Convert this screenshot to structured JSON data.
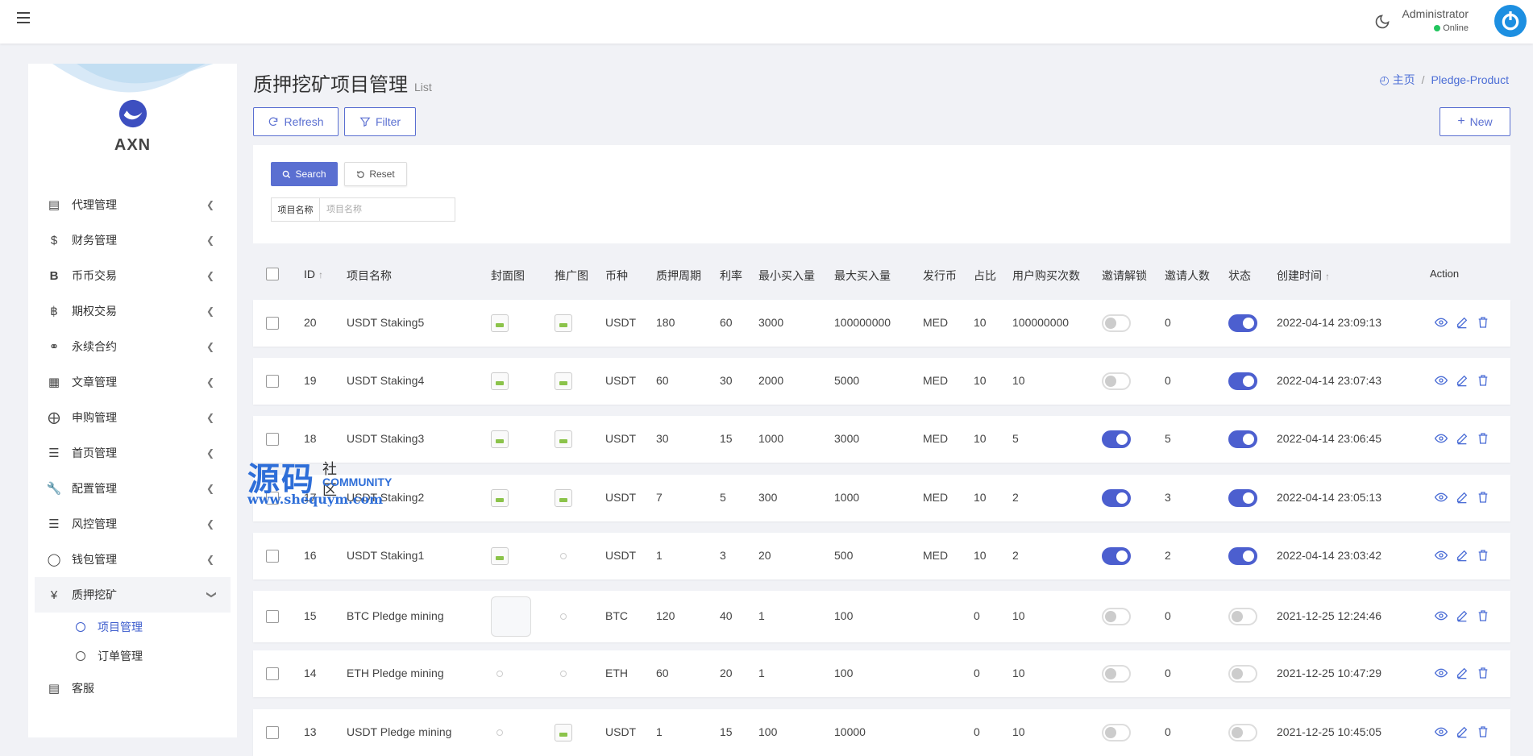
{
  "topbar": {
    "admin_name": "Administrator",
    "status": "Online"
  },
  "sidebar": {
    "logo_text": "AXN",
    "menu": [
      {
        "label": "代理管理",
        "icon": "id-card-icon"
      },
      {
        "label": "财务管理",
        "icon": "dollar-icon"
      },
      {
        "label": "币币交易",
        "icon": "bitcoin-b-icon"
      },
      {
        "label": "期权交易",
        "icon": "bitcoin-icon"
      },
      {
        "label": "永续合约",
        "icon": "link-icon"
      },
      {
        "label": "文章管理",
        "icon": "newspaper-icon"
      },
      {
        "label": "申购管理",
        "icon": "lifebuoy-icon"
      },
      {
        "label": "首页管理",
        "icon": "list-icon"
      },
      {
        "label": "配置管理",
        "icon": "wrench-icon"
      },
      {
        "label": "风控管理",
        "icon": "list-ul-icon"
      },
      {
        "label": "钱包管理",
        "icon": "circle-icon"
      },
      {
        "label": "质押挖矿",
        "icon": "yen-icon"
      }
    ],
    "submenu": [
      {
        "label": "项目管理",
        "active": true
      },
      {
        "label": "订单管理",
        "active": false
      }
    ],
    "bottom_item": {
      "label": "客服",
      "icon": "id-card-icon"
    }
  },
  "header": {
    "title": "质押挖矿项目管理",
    "subtitle": "List",
    "breadcrumb_home": "主页",
    "breadcrumb_current": "Pledge-Product"
  },
  "toolbar": {
    "refresh": "Refresh",
    "filter": "Filter",
    "new": "New"
  },
  "filter_panel": {
    "search": "Search",
    "reset": "Reset",
    "field_label": "项目名称",
    "field_placeholder": "项目名称"
  },
  "table": {
    "columns": [
      "ID",
      "项目名称",
      "封面图",
      "推广图",
      "币种",
      "质押周期",
      "利率",
      "最小买入量",
      "最大买入量",
      "发行币",
      "占比",
      "用户购买次数",
      "邀请解锁",
      "邀请人数",
      "状态",
      "创建时间",
      "Action"
    ],
    "rows": [
      {
        "id": "20",
        "name": "USDT Staking5",
        "cover": "img",
        "promo": "img",
        "coin": "USDT",
        "period": "180",
        "rate": "60",
        "min": "3000",
        "max": "100000000",
        "issue": "MED",
        "ratio": "10",
        "buys": "100000000",
        "invite_unlock": false,
        "invites": "0",
        "status": true,
        "created": "2022-04-14 23:09:13"
      },
      {
        "id": "19",
        "name": "USDT Staking4",
        "cover": "img",
        "promo": "img",
        "coin": "USDT",
        "period": "60",
        "rate": "30",
        "min": "2000",
        "max": "5000",
        "issue": "MED",
        "ratio": "10",
        "buys": "10",
        "invite_unlock": false,
        "invites": "0",
        "status": true,
        "created": "2022-04-14 23:07:43"
      },
      {
        "id": "18",
        "name": "USDT Staking3",
        "cover": "img",
        "promo": "img",
        "coin": "USDT",
        "period": "30",
        "rate": "15",
        "min": "1000",
        "max": "3000",
        "issue": "MED",
        "ratio": "10",
        "buys": "5",
        "invite_unlock": true,
        "invites": "5",
        "status": true,
        "created": "2022-04-14 23:06:45"
      },
      {
        "id": "17",
        "name": "USDT Staking2",
        "cover": "img",
        "promo": "img",
        "coin": "USDT",
        "period": "7",
        "rate": "5",
        "min": "300",
        "max": "1000",
        "issue": "MED",
        "ratio": "10",
        "buys": "2",
        "invite_unlock": true,
        "invites": "3",
        "status": true,
        "created": "2022-04-14 23:05:13"
      },
      {
        "id": "16",
        "name": "USDT Staking1",
        "cover": "img",
        "promo": "dot",
        "coin": "USDT",
        "period": "1",
        "rate": "3",
        "min": "20",
        "max": "500",
        "issue": "MED",
        "ratio": "10",
        "buys": "2",
        "invite_unlock": true,
        "invites": "2",
        "status": true,
        "created": "2022-04-14 23:03:42"
      },
      {
        "id": "15",
        "name": "BTC Pledge mining",
        "cover": "big",
        "promo": "dot",
        "coin": "BTC",
        "period": "120",
        "rate": "40",
        "min": "1",
        "max": "100",
        "issue": "",
        "ratio": "0",
        "buys": "10",
        "invite_unlock": false,
        "invites": "0",
        "status": false,
        "created": "2021-12-25 12:24:46"
      },
      {
        "id": "14",
        "name": "ETH Pledge mining",
        "cover": "dot",
        "promo": "dot",
        "coin": "ETH",
        "period": "60",
        "rate": "20",
        "min": "1",
        "max": "100",
        "issue": "",
        "ratio": "0",
        "buys": "10",
        "invite_unlock": false,
        "invites": "0",
        "status": false,
        "created": "2021-12-25 10:47:29"
      },
      {
        "id": "13",
        "name": "USDT Pledge mining",
        "cover": "dot",
        "promo": "img",
        "coin": "USDT",
        "period": "1",
        "rate": "15",
        "min": "100",
        "max": "10000",
        "issue": "",
        "ratio": "0",
        "buys": "10",
        "invite_unlock": false,
        "invites": "0",
        "status": false,
        "created": "2021-12-25 10:45:05"
      }
    ]
  },
  "watermark": {
    "big": "源码",
    "small": "社区",
    "community": "COMMUNITY",
    "url": "www.shequym.com"
  },
  "colors": {
    "accent": "#5a6fd1",
    "toggle_on": "#4c5fcf",
    "link": "#4c6ed6",
    "online": "#22c55e"
  }
}
